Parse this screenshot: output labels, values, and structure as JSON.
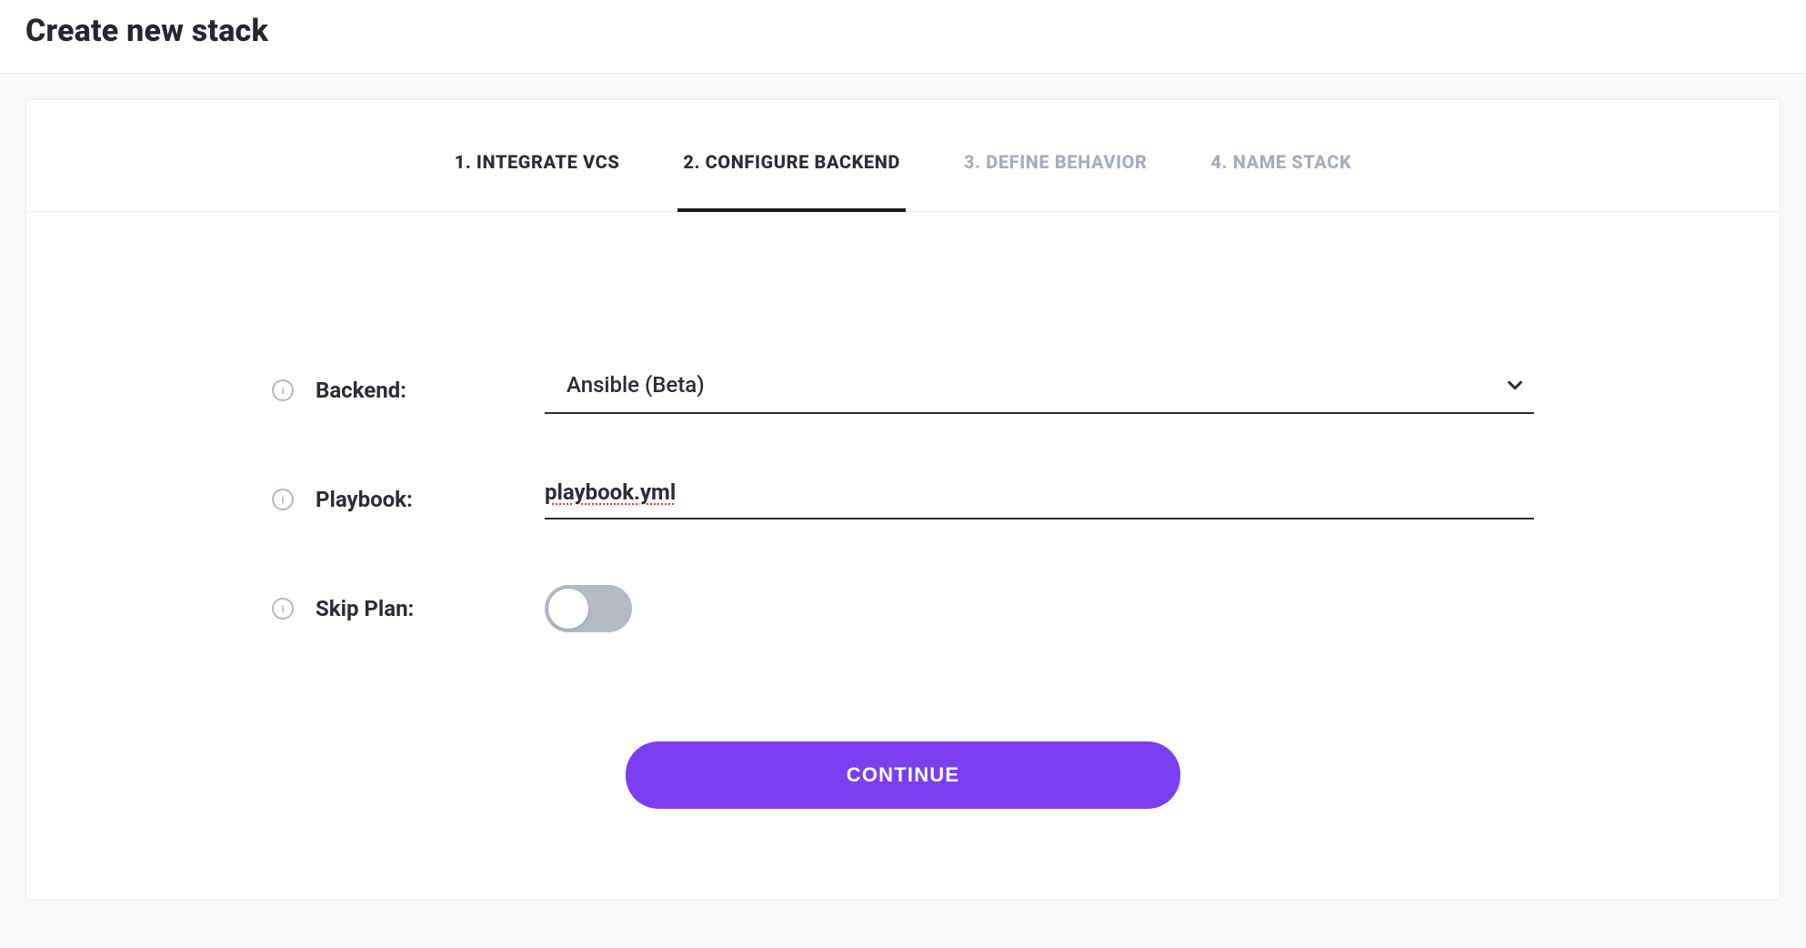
{
  "header": {
    "title": "Create new stack"
  },
  "tabs": [
    {
      "label": "1. INTEGRATE VCS",
      "state": "completed"
    },
    {
      "label": "2. CONFIGURE BACKEND",
      "state": "active"
    },
    {
      "label": "3. DEFINE BEHAVIOR",
      "state": "upcoming"
    },
    {
      "label": "4. NAME STACK",
      "state": "upcoming"
    }
  ],
  "form": {
    "backend": {
      "label": "Backend:",
      "selected": "Ansible (Beta)"
    },
    "playbook": {
      "label": "Playbook:",
      "value": "playbook.yml"
    },
    "skipPlan": {
      "label": "Skip Plan:",
      "enabled": false
    }
  },
  "actions": {
    "continue": "CONTINUE"
  },
  "icons": {
    "info": "info-icon",
    "chevron": "chevron-down-icon"
  }
}
